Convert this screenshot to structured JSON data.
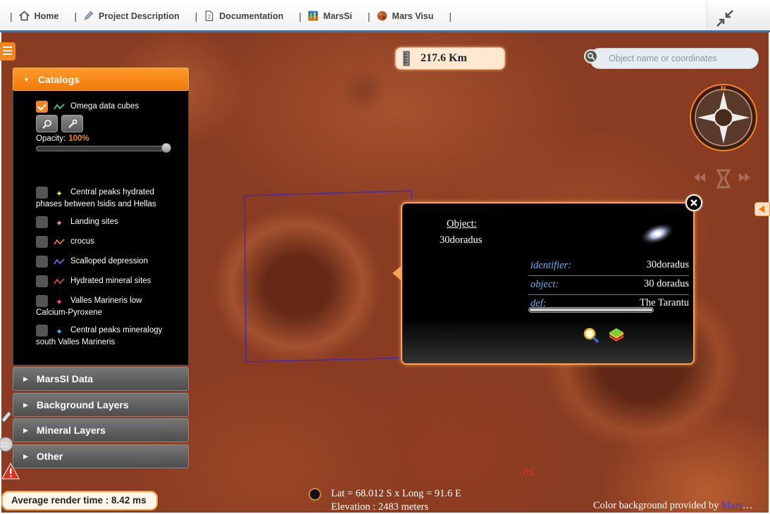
{
  "nav": {
    "items": [
      {
        "label": "Home",
        "icon": "home-icon"
      },
      {
        "label": "Project Description",
        "icon": "pencil-icon"
      },
      {
        "label": "Documentation",
        "icon": "document-icon"
      },
      {
        "label": "MarsSi",
        "icon": "marssi-logo-icon"
      },
      {
        "label": "Mars Visu",
        "icon": "mars-planet-icon"
      }
    ],
    "separator": "|"
  },
  "scale": {
    "value": "217.6 Km"
  },
  "search": {
    "placeholder": "Object name or coordinates"
  },
  "panel": {
    "catalogs_header": "Catalogs",
    "omega": {
      "label": "Omega data cubes",
      "checked": true
    },
    "opacity_label": "Opacity:",
    "opacity_value": "100%",
    "opacity_fraction": 1.0,
    "catalogs": [
      {
        "line1": "Central peaks hydrated",
        "line2": "phases between Isidis and Hellas",
        "icon": "star-icon",
        "color": "#e5e545"
      },
      {
        "line1": "Landing sites",
        "line2": "",
        "icon": "star-icon",
        "color": "#f5a060"
      },
      {
        "line1": "crocus",
        "line2": "",
        "icon": "polyline-icon",
        "color": "#f5841f"
      },
      {
        "line1": "Scalloped depression",
        "line2": "",
        "icon": "polyline-icon",
        "color": "#8b5cf0"
      },
      {
        "line1": "Hydrated mineral sites",
        "line2": "",
        "icon": "polyline-icon",
        "color": "#e84a4a"
      },
      {
        "line1": "Valles Marineris low",
        "line2": "Calcium-Pyroxene",
        "icon": "star-icon",
        "color": "#ff4aa0"
      },
      {
        "line1": "Central peaks mineralogy",
        "line2": "south Valles Marineris",
        "icon": "star-icon",
        "color": "#4ab8f0"
      }
    ],
    "sections": [
      "MarsSI Data",
      "Background Layers",
      "Mineral Layers",
      "Other"
    ]
  },
  "popup": {
    "title": "Object:",
    "name": "30doradus",
    "rows": [
      {
        "key": "identifier:",
        "value": "30doradus"
      },
      {
        "key": "object:",
        "value": "30 doradus"
      },
      {
        "key": "def:",
        "value": "The Tarantu"
      }
    ]
  },
  "render_time": "Average render time : 8.42 ms",
  "coords": {
    "latlong": "Lat = 68.012 S x Long = 91.6 E",
    "elevation": "Elevation : 2483 meters"
  },
  "ns_text": "ns",
  "credit": {
    "text": "Color background provided by ",
    "link": "Mars",
    "ellipsis": "…"
  },
  "colors": {
    "accent": "#f5841f",
    "nav_border": "#2e78c0",
    "footprint": "#4a2aa8"
  }
}
